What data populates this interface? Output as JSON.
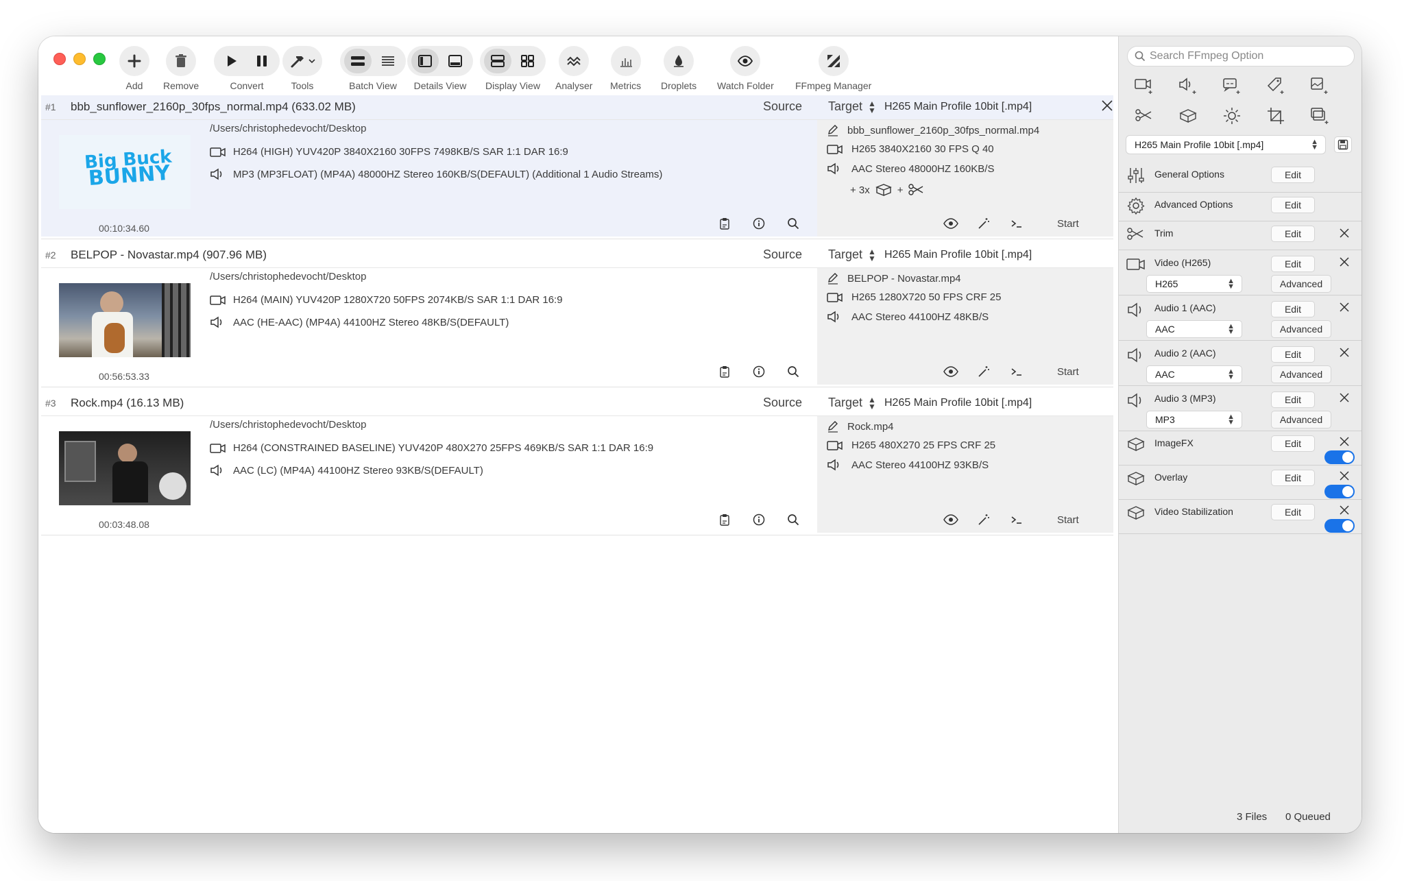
{
  "toolbar": {
    "add": "Add",
    "remove": "Remove",
    "convert": "Convert",
    "tools": "Tools",
    "batch_view": "Batch View",
    "details_view": "Details View",
    "display_view": "Display View",
    "analyser": "Analyser",
    "metrics": "Metrics",
    "droplets": "Droplets",
    "watch_folder": "Watch Folder",
    "ffmpeg_manager": "FFmpeg Manager"
  },
  "labels": {
    "source": "Source",
    "target": "Target",
    "start": "Start"
  },
  "files": [
    {
      "num": "#1",
      "name": "bbb_sunflower_2160p_30fps_normal.mp4  (633.02 MB)",
      "path": "/Users/christophedevocht/Desktop",
      "video": "H264 (HIGH) YUV420P 3840X2160  30FPS 7498KB/S SAR 1:1 DAR 16:9",
      "audio": "MP3 (MP3FLOAT) (MP4A) 48000HZ Stereo 160KB/S(DEFAULT) (Additional 1 Audio Streams)",
      "duration": "00:10:34.60",
      "preset": "H265 Main Profile 10bit [.mp4]",
      "out_name": "bbb_sunflower_2160p_30fps_normal.mp4",
      "out_video": "H265 3840X2160 30 FPS Q 40",
      "out_audio": "AAC Stereo 48000HZ 160KB/S",
      "extra": "+ 3x",
      "thumb_text_1": "Big Buck",
      "thumb_text_2": "BUNNY"
    },
    {
      "num": "#2",
      "name": "BELPOP  - Novastar.mp4  (907.96 MB)",
      "path": "/Users/christophedevocht/Desktop",
      "video": "H264 (MAIN) YUV420P 1280X720  50FPS 2074KB/S SAR 1:1 DAR 16:9",
      "audio": "AAC (HE-AAC) (MP4A) 44100HZ Stereo 48KB/S(DEFAULT)",
      "duration": "00:56:53.33",
      "preset": "H265 Main Profile 10bit [.mp4]",
      "out_name": "BELPOP  - Novastar.mp4",
      "out_video": "H265 1280X720 50 FPS CRF 25",
      "out_audio": "AAC Stereo 44100HZ 48KB/S"
    },
    {
      "num": "#3",
      "name": "Rock.mp4  (16.13 MB)",
      "path": "/Users/christophedevocht/Desktop",
      "video": "H264 (CONSTRAINED BASELINE) YUV420P 480X270  25FPS 469KB/S SAR 1:1 DAR 16:9",
      "audio": "AAC (LC) (MP4A) 44100HZ Stereo 93KB/S(DEFAULT)",
      "duration": "00:03:48.08",
      "preset": "H265 Main Profile 10bit [.mp4]",
      "out_name": "Rock.mp4",
      "out_video": "H265 480X270 25 FPS CRF 25",
      "out_audio": "AAC Stereo 44100HZ 93KB/S"
    }
  ],
  "sidebar": {
    "search_placeholder": "Search FFmpeg Option",
    "preset": "H265 Main Profile 10bit [.mp4]",
    "edit": "Edit",
    "advanced": "Advanced",
    "sections": {
      "general": "General Options",
      "advanced_opts": "Advanced Options",
      "trim": "Trim",
      "video": "Video (H265)",
      "video_codec": "H265",
      "audio1": "Audio 1 (AAC)",
      "audio1_codec": "AAC",
      "audio2": "Audio 2 (AAC)",
      "audio2_codec": "AAC",
      "audio3": "Audio 3 (MP3)",
      "audio3_codec": "MP3",
      "imagefx": "ImageFX",
      "overlay": "Overlay",
      "stabilization": "Video Stabilization"
    }
  },
  "status": {
    "files": "3 Files",
    "queued": "0 Queued"
  },
  "colors": {
    "accent": "#1a73e8",
    "selected_row": "#eef1fa",
    "sidebar_bg": "#ebebeb"
  }
}
